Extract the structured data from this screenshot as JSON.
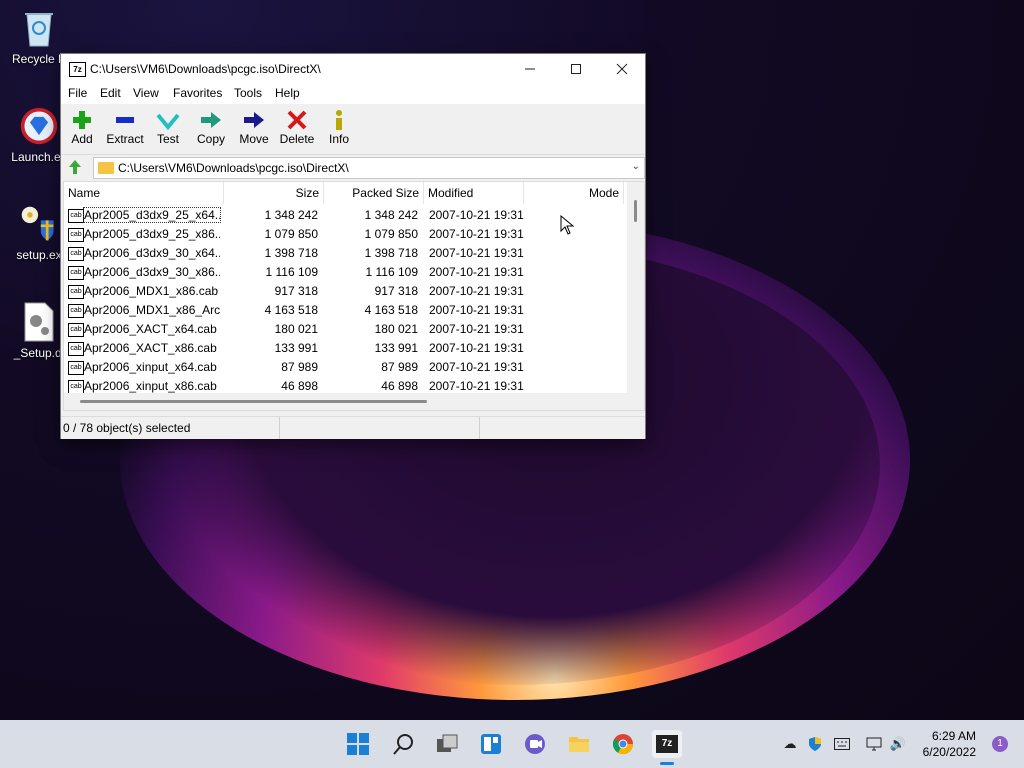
{
  "desktop": {
    "icons": [
      {
        "label": "Recycle B"
      },
      {
        "label": "Launch.ex"
      },
      {
        "label": "setup.ex"
      },
      {
        "label": "_Setup.dl"
      }
    ]
  },
  "window": {
    "app_icon_text": "7z",
    "title": "C:\\Users\\VM6\\Downloads\\pcgc.iso\\DirectX\\",
    "menu": [
      "File",
      "Edit",
      "View",
      "Favorites",
      "Tools",
      "Help"
    ],
    "toolbar": [
      {
        "label": "Add",
        "icon": "plus-icon",
        "color": "#1aa31a"
      },
      {
        "label": "Extract",
        "icon": "minus-icon",
        "color": "#1a2cc8"
      },
      {
        "label": "Test",
        "icon": "check-icon",
        "color": "#22c0c0"
      },
      {
        "label": "Copy",
        "icon": "copy-arrow-icon",
        "color": "#1f9a7a"
      },
      {
        "label": "Move",
        "icon": "move-arrow-icon",
        "color": "#1a1a8a"
      },
      {
        "label": "Delete",
        "icon": "x-icon",
        "color": "#d21a1a"
      },
      {
        "label": "Info",
        "icon": "info-icon",
        "color": "#b8a800"
      }
    ],
    "address": "C:\\Users\\VM6\\Downloads\\pcgc.iso\\DirectX\\",
    "columns": [
      "Name",
      "Size",
      "Packed Size",
      "Modified",
      "Mode"
    ],
    "files": [
      {
        "name": "Apr2005_d3dx9_25_x64....",
        "size": "1 348 242",
        "packed": "1 348 242",
        "modified": "2007-10-21 19:31"
      },
      {
        "name": "Apr2005_d3dx9_25_x86....",
        "size": "1 079 850",
        "packed": "1 079 850",
        "modified": "2007-10-21 19:31"
      },
      {
        "name": "Apr2006_d3dx9_30_x64....",
        "size": "1 398 718",
        "packed": "1 398 718",
        "modified": "2007-10-21 19:31"
      },
      {
        "name": "Apr2006_d3dx9_30_x86....",
        "size": "1 116 109",
        "packed": "1 116 109",
        "modified": "2007-10-21 19:31"
      },
      {
        "name": "Apr2006_MDX1_x86.cab",
        "size": "917 318",
        "packed": "917 318",
        "modified": "2007-10-21 19:31"
      },
      {
        "name": "Apr2006_MDX1_x86_Arc...",
        "size": "4 163 518",
        "packed": "4 163 518",
        "modified": "2007-10-21 19:31"
      },
      {
        "name": "Apr2006_XACT_x64.cab",
        "size": "180 021",
        "packed": "180 021",
        "modified": "2007-10-21 19:31"
      },
      {
        "name": "Apr2006_XACT_x86.cab",
        "size": "133 991",
        "packed": "133 991",
        "modified": "2007-10-21 19:31"
      },
      {
        "name": "Apr2006_xinput_x64.cab",
        "size": "87 989",
        "packed": "87 989",
        "modified": "2007-10-21 19:31"
      },
      {
        "name": "Apr2006_xinput_x86.cab",
        "size": "46 898",
        "packed": "46 898",
        "modified": "2007-10-21 19:31"
      }
    ],
    "status": "0 / 78 object(s) selected"
  },
  "taskbar": {
    "time": "6:29 AM",
    "date": "6/20/2022",
    "notification_count": "1",
    "active_app_text": "7z"
  }
}
